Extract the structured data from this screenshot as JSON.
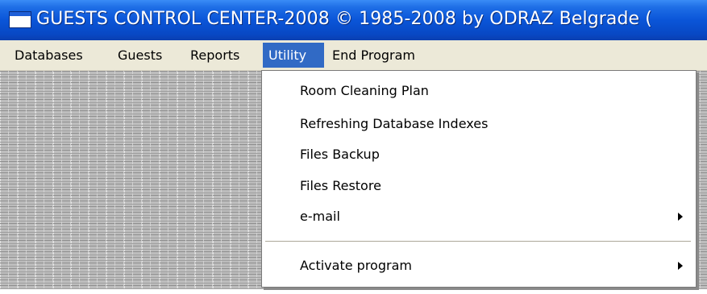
{
  "window": {
    "title": "GUESTS CONTROL CENTER-2008 © 1985-2008 by ODRAZ Belgrade (",
    "icon": "app-window-icon"
  },
  "menubar": {
    "items": [
      {
        "label": "Databases"
      },
      {
        "label": "Guests"
      },
      {
        "label": "Reports"
      },
      {
        "label": "Utility",
        "active": true
      },
      {
        "label": "End Program"
      }
    ]
  },
  "utility_menu": {
    "items": [
      {
        "label": "Room Cleaning Plan"
      },
      {
        "label": "Refreshing Database Indexes"
      },
      {
        "label": "Files Backup"
      },
      {
        "label": "Files Restore"
      },
      {
        "label": "e-mail",
        "submenu": true
      },
      {
        "label": "Activate program",
        "submenu": true
      }
    ]
  },
  "colors": {
    "titlebar": "#0a55d8",
    "menu_highlight": "#316ac5",
    "menubar_bg": "#ece9d8",
    "menu_bg": "#ffffff"
  }
}
